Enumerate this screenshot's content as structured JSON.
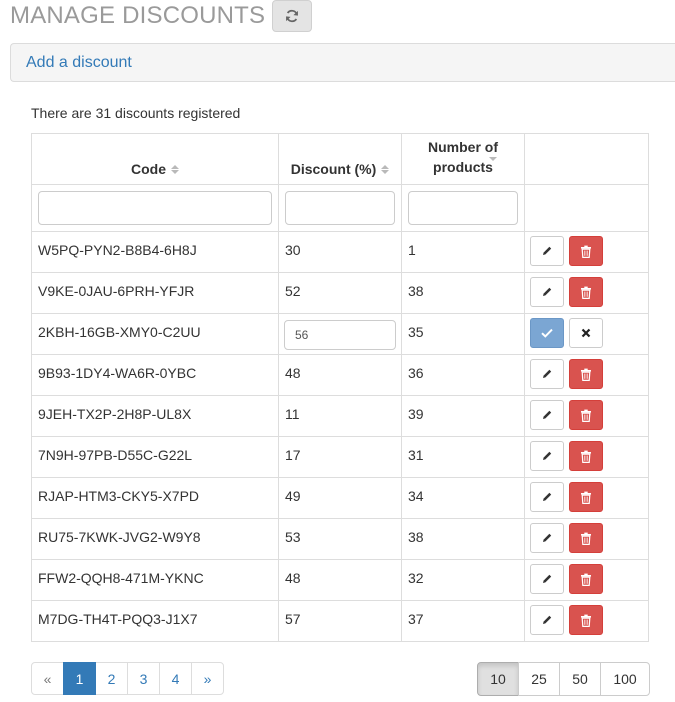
{
  "header": {
    "title": "MANAGE DISCOUNTS",
    "refresh_icon": "refresh-icon"
  },
  "panel": {
    "add_link": "Add a discount"
  },
  "summary": "There are 31 discounts registered",
  "columns": {
    "code": "Code",
    "discount": "Discount (%)",
    "products_line1": "Number of",
    "products_line2": "products"
  },
  "rows": [
    {
      "code": "W5PQ-PYN2-B8B4-6H8J",
      "discount": "30",
      "products": "1"
    },
    {
      "code": "V9KE-0JAU-6PRH-YFJR",
      "discount": "52",
      "products": "38"
    },
    {
      "code": "2KBH-16GB-XMY0-C2UU",
      "discount": "56",
      "products": "35"
    },
    {
      "code": "9B93-1DY4-WA6R-0YBC",
      "discount": "48",
      "products": "36"
    },
    {
      "code": "9JEH-TX2P-2H8P-UL8X",
      "discount": "11",
      "products": "39"
    },
    {
      "code": "7N9H-97PB-D55C-G22L",
      "discount": "17",
      "products": "31"
    },
    {
      "code": "RJAP-HTM3-CKY5-X7PD",
      "discount": "49",
      "products": "34"
    },
    {
      "code": "RU75-7KWK-JVG2-W9Y8",
      "discount": "53",
      "products": "38"
    },
    {
      "code": "FFW2-QQH8-471M-YKNC",
      "discount": "48",
      "products": "32"
    },
    {
      "code": "M7DG-TH4T-PQQ3-J1X7",
      "discount": "57",
      "products": "37"
    }
  ],
  "pagination": {
    "prev": "«",
    "pages": [
      "1",
      "2",
      "3",
      "4"
    ],
    "next": "»",
    "current": "1"
  },
  "page_size": {
    "options": [
      "10",
      "25",
      "50",
      "100"
    ],
    "selected": "10"
  },
  "colors": {
    "link": "#337ab7",
    "danger": "#d9534f",
    "confirm": "#7ba6d3",
    "title": "#9a9a9a"
  }
}
